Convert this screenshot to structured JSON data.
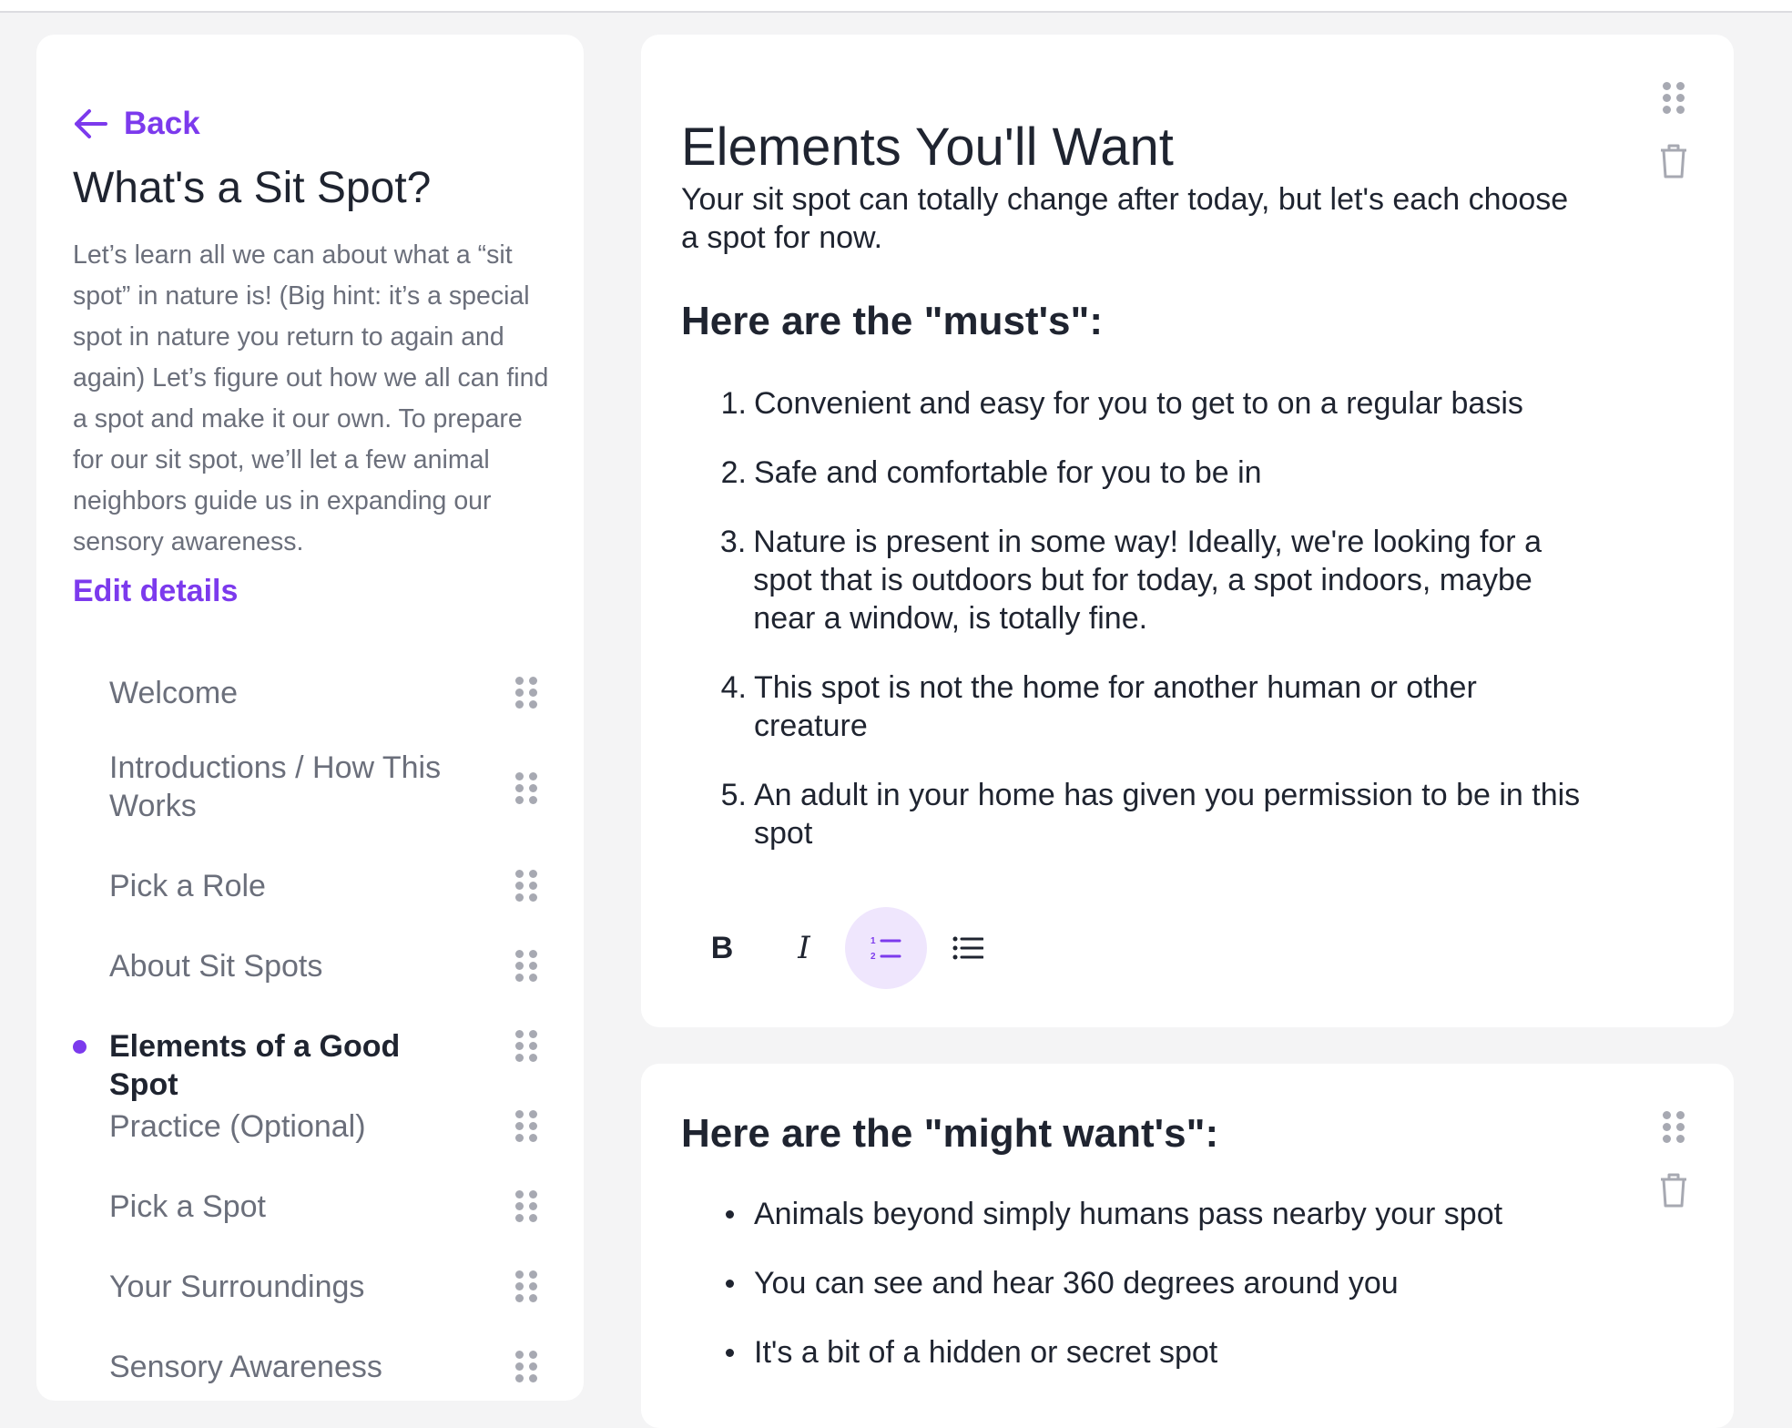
{
  "sidebar": {
    "back_label": "Back",
    "title": "What's a Sit Spot?",
    "description": "Let’s learn all we can about what a “sit spot” in nature is! (Big hint: it’s a special spot in nature you return to again and again) Let’s figure out how we all can find a spot and make it our own. To prepare for our sit spot, we’ll let a few animal neighbors guide us in expanding our sensory awareness.",
    "edit_label": "Edit details",
    "items": [
      {
        "label": "Welcome",
        "active": false
      },
      {
        "label": "Introductions / How This Works",
        "active": false
      },
      {
        "label": "Pick a Role",
        "active": false
      },
      {
        "label": "About Sit Spots",
        "active": false
      },
      {
        "label": "Elements of a Good Spot",
        "active": true
      },
      {
        "label": "Practice (Optional)",
        "active": false
      },
      {
        "label": "Pick a Spot",
        "active": false
      },
      {
        "label": "Your Surroundings",
        "active": false
      },
      {
        "label": "Sensory Awareness",
        "active": false
      }
    ]
  },
  "card1": {
    "title": "Elements You'll Want",
    "intro": "Your sit spot can totally change after today, but let's each choose a spot for now.",
    "musts_heading": "Here are the \"must's\":",
    "musts": [
      {
        "num": "1.",
        "text": "Convenient and easy for you to get to on a regular basis"
      },
      {
        "num": "2.",
        "text": "Safe and comfortable for you to be in"
      },
      {
        "num": "3.",
        "text": "Nature is present in some way! Ideally, we're looking for a spot that is outdoors but for today, a spot indoors, maybe near a window, is totally fine."
      },
      {
        "num": "4.",
        "text": "This spot is not the home for another human or other creature"
      },
      {
        "num": "5.",
        "text": "An adult in your home has given you permission to be in this spot"
      }
    ],
    "toolbar": {
      "bold_label": "B",
      "italic_label": "I",
      "active_tool": "numbered-list"
    }
  },
  "card2": {
    "heading": "Here are the \"might want's\":",
    "items": [
      "Animals beyond simply humans pass nearby your spot",
      "You can see and hear 360 degrees around you",
      "It's a bit of a hidden or secret spot"
    ]
  },
  "icons": {
    "back": "arrow-left-icon",
    "drag": "drag-handle-icon",
    "delete": "trash-icon",
    "numbered_list": "numbered-list-icon",
    "bulleted_list": "bulleted-list-icon"
  },
  "colors": {
    "accent": "#7c3aed",
    "accent_soft": "#efe6fd",
    "text_primary": "#1f2430",
    "text_muted": "#6b6f7b",
    "background": "#f4f4f5"
  }
}
